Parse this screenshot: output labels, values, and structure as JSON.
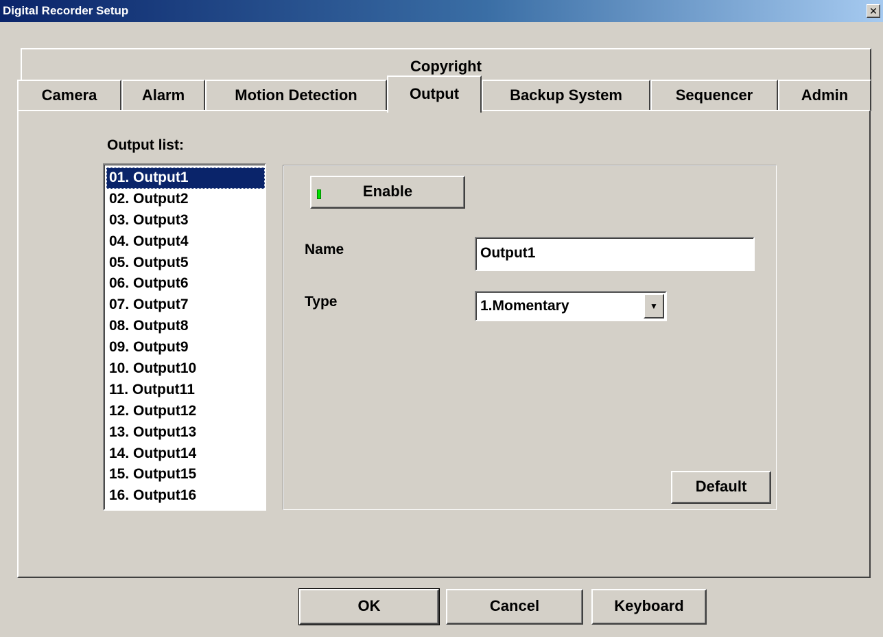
{
  "window": {
    "title": "Digital Recorder Setup",
    "close_glyph": "✕"
  },
  "tabs": {
    "top_row": [
      "Copyright"
    ],
    "bottom_row": [
      "Camera",
      "Alarm",
      "Motion Detection",
      "Output",
      "Backup System",
      "Sequencer",
      "Admin"
    ],
    "active": "Output"
  },
  "output_panel": {
    "list_label": "Output list:",
    "items": [
      "01. Output1",
      "02. Output2",
      "03. Output3",
      "04. Output4",
      "05. Output5",
      "06. Output6",
      "07. Output7",
      "08. Output8",
      "09. Output9",
      "10. Output10",
      "11. Output11",
      "12. Output12",
      "13. Output13",
      "14. Output14",
      "15. Output15",
      "16. Output16"
    ],
    "selected_index": 0,
    "enable_label": "Enable",
    "enable_indicator_color": "#00e000",
    "name_label": "Name",
    "name_value": "Output1",
    "type_label": "Type",
    "type_value": "1.Momentary",
    "default_label": "Default"
  },
  "footer": {
    "ok_label": "OK",
    "cancel_label": "Cancel",
    "keyboard_label": "Keyboard"
  }
}
